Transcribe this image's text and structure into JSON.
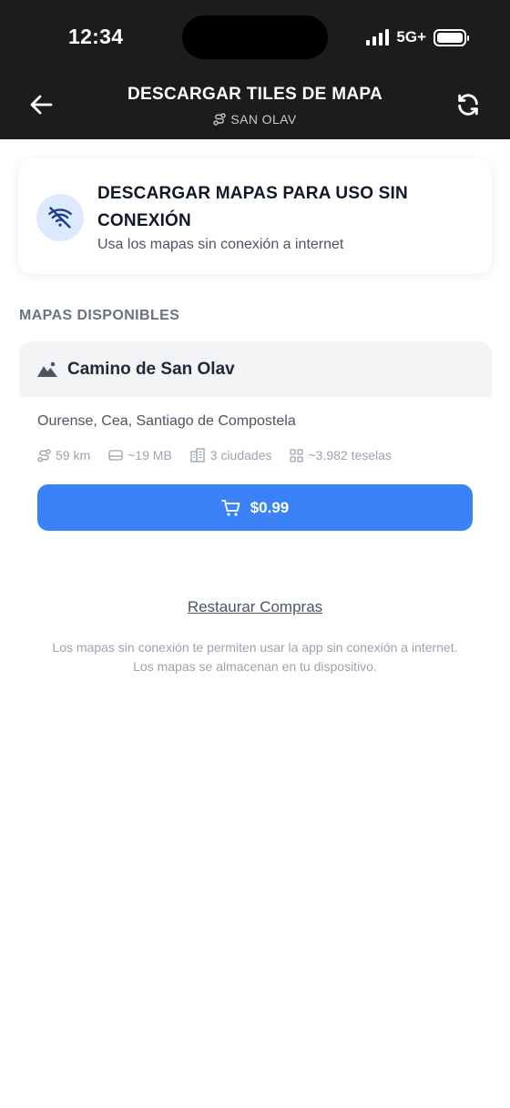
{
  "status_bar": {
    "time": "12:34",
    "network": "5G+",
    "signal_bars": 4,
    "battery_percent": 100
  },
  "header": {
    "title": "DESCARGAR TILES DE MAPA",
    "subtitle": "SAN OLAV",
    "back_icon": "arrow-left-icon",
    "refresh_icon": "refresh-icon",
    "subtitle_icon": "route-icon"
  },
  "offline_card": {
    "icon": "wifi-off-icon",
    "title": "DESCARGAR MAPAS PARA USO SIN CONEXIÓN",
    "description": "Usa los mapas sin conexión a internet"
  },
  "section": {
    "title": "MAPAS DISPONIBLES"
  },
  "maps": [
    {
      "icon": "mountain-icon",
      "name": "Camino de San Olav",
      "cities": "Ourense, Cea, Santiago de Compostela",
      "stats": {
        "distance": "59 km",
        "size": "~19 MB",
        "city_count": "3 ciudades",
        "tiles": "~3.982 teselas"
      },
      "price": "$0.99"
    }
  ],
  "restore_label": "Restaurar Compras",
  "footnote": {
    "line1": "Los mapas sin conexión te permiten usar la app sin conexión a internet.",
    "line2": "Los mapas se almacenan en tu dispositivo."
  },
  "colors": {
    "header_bg": "#1c1c1c",
    "accent": "#3b82f6",
    "icon_bg": "#dbeafe",
    "icon_color": "#1e3a8a"
  }
}
